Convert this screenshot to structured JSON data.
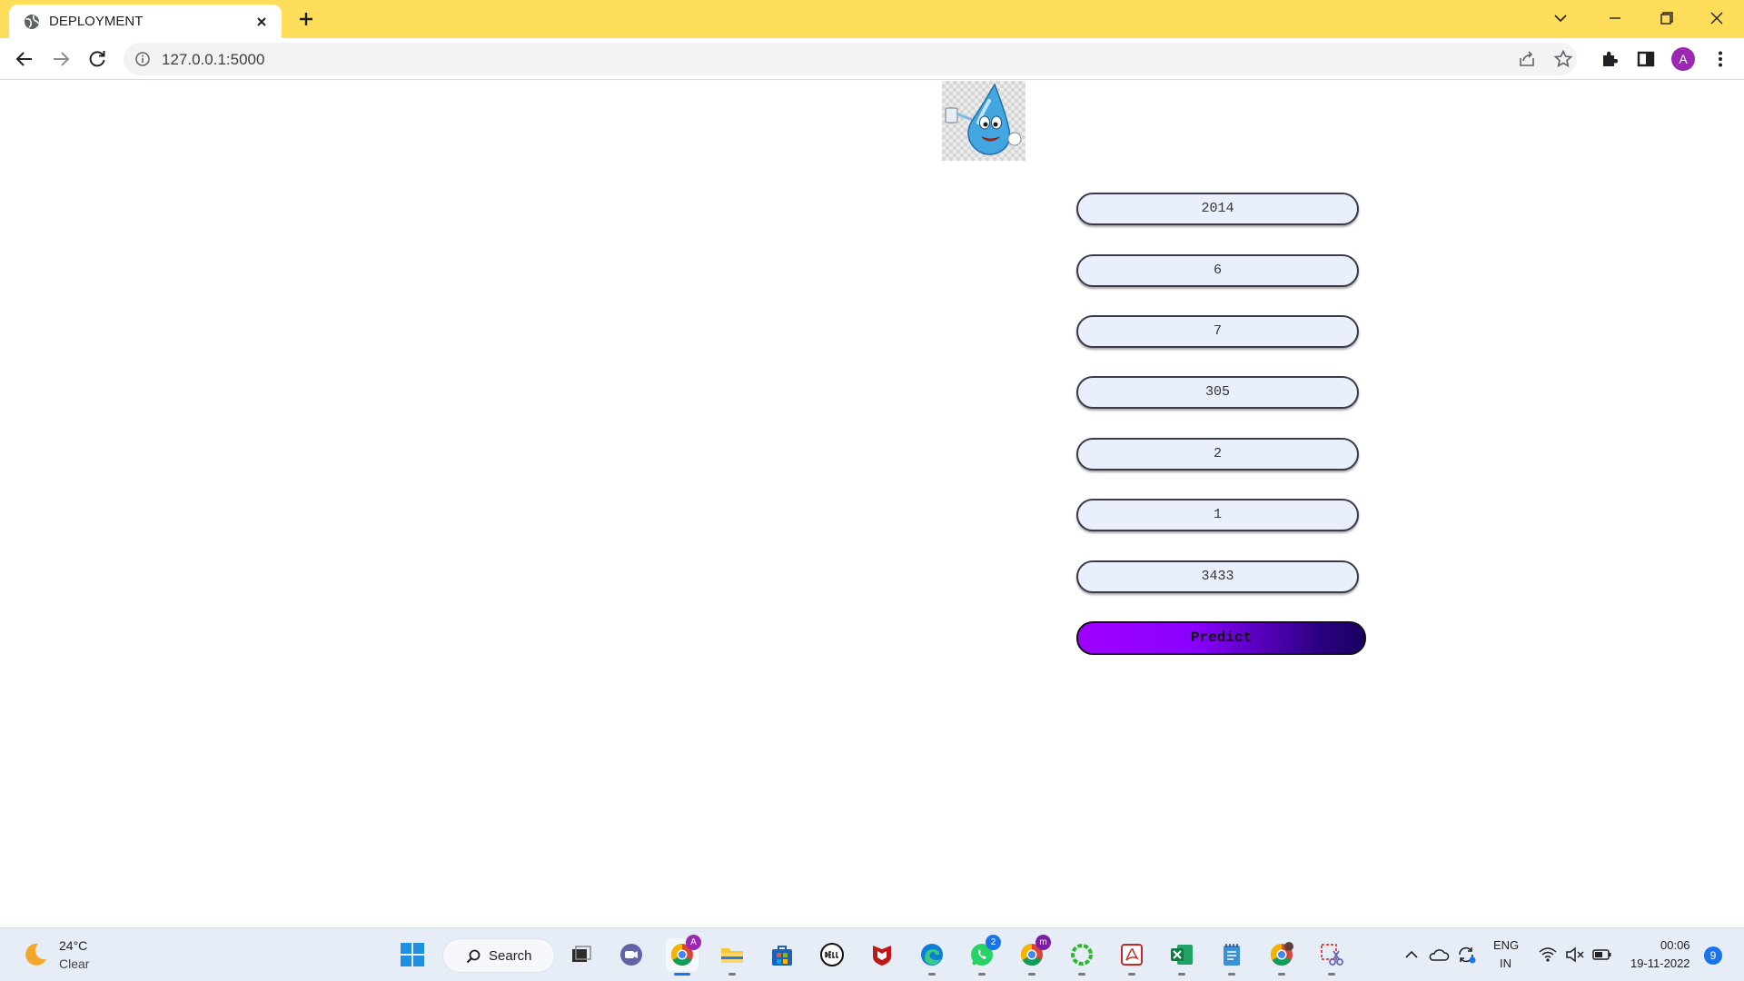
{
  "browser": {
    "tab_title": "DEPLOYMENT",
    "url": "127.0.0.1:5000",
    "profile_initial": "A"
  },
  "page": {
    "fields": [
      {
        "value": "2014"
      },
      {
        "value": "6"
      },
      {
        "value": "7"
      },
      {
        "value": "305"
      },
      {
        "value": "2"
      },
      {
        "value": "1"
      },
      {
        "value": "3433"
      }
    ],
    "predict_label": "Predict",
    "colors": {
      "field_bg": "#eaf0fb",
      "predict_gradient_start": "#a000ff",
      "predict_gradient_end": "#1a0060"
    }
  },
  "taskbar": {
    "weather_temp": "24°C",
    "weather_condition": "Clear",
    "search_label": "Search",
    "apps": [
      {
        "name": "start-button"
      },
      {
        "name": "task-view-app"
      },
      {
        "name": "teams-chat-app"
      },
      {
        "name": "chrome-app",
        "badge": "A",
        "active": true
      },
      {
        "name": "file-explorer-app"
      },
      {
        "name": "microsoft-store-app"
      },
      {
        "name": "dell-app"
      },
      {
        "name": "mcafee-app"
      },
      {
        "name": "edge-app"
      },
      {
        "name": "whatsapp-app",
        "badge": "2"
      },
      {
        "name": "chrome-profile-app",
        "badge": "m"
      },
      {
        "name": "loading-app"
      },
      {
        "name": "pdf-app"
      },
      {
        "name": "excel-app"
      },
      {
        "name": "notepad-app"
      },
      {
        "name": "chrome-other-profile-app"
      },
      {
        "name": "snipping-tool-app"
      }
    ],
    "language": "ENG",
    "region": "IN",
    "time": "00:06",
    "date": "19-11-2022",
    "notification_count": "9"
  }
}
